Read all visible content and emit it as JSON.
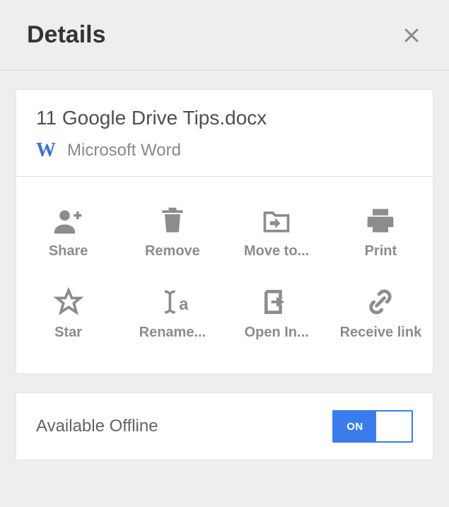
{
  "header": {
    "title": "Details"
  },
  "file": {
    "name": "11 Google Drive Tips.docx",
    "type_label": "Microsoft Word",
    "icon_glyph": "W"
  },
  "actions": [
    {
      "id": "share",
      "label": "Share"
    },
    {
      "id": "remove",
      "label": "Remove"
    },
    {
      "id": "moveto",
      "label": "Move to..."
    },
    {
      "id": "print",
      "label": "Print"
    },
    {
      "id": "star",
      "label": "Star"
    },
    {
      "id": "rename",
      "label": "Rename..."
    },
    {
      "id": "openin",
      "label": "Open In..."
    },
    {
      "id": "receivelink",
      "label": "Receive link"
    }
  ],
  "offline": {
    "label": "Available Offline",
    "toggle_state": "ON"
  }
}
